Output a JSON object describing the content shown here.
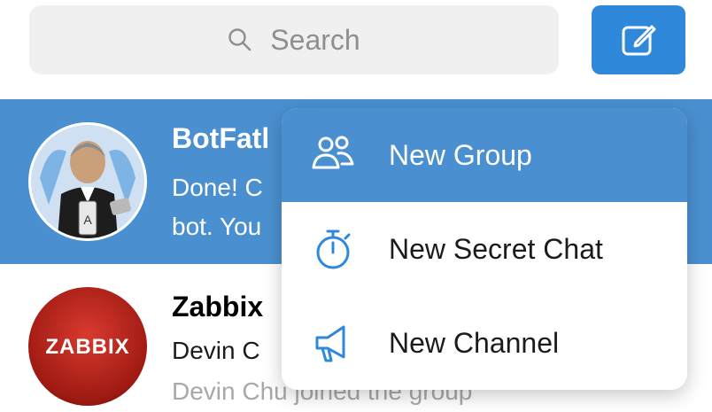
{
  "search": {
    "placeholder": "Search",
    "icon": "search-icon"
  },
  "compose_button": {
    "icon": "compose-icon",
    "color": "#2f88d9"
  },
  "chats": [
    {
      "title": "BotFatl",
      "line1": "Done! C",
      "line2": "bot. You",
      "selected": true
    },
    {
      "title": "Zabbix",
      "line1": "Devin C",
      "line2": "Devin Chu joined the group",
      "avatar_text": "ZABBIX",
      "selected": false
    }
  ],
  "menu": {
    "items": [
      {
        "label": "New Group",
        "icon": "group-icon",
        "highlighted": true
      },
      {
        "label": "New Secret Chat",
        "icon": "stopwatch-icon",
        "highlighted": false
      },
      {
        "label": "New Channel",
        "icon": "megaphone-icon",
        "highlighted": false
      }
    ]
  },
  "colors": {
    "accent": "#4a90d0",
    "compose": "#2f88d9",
    "search_bg": "#f0f0f1"
  }
}
